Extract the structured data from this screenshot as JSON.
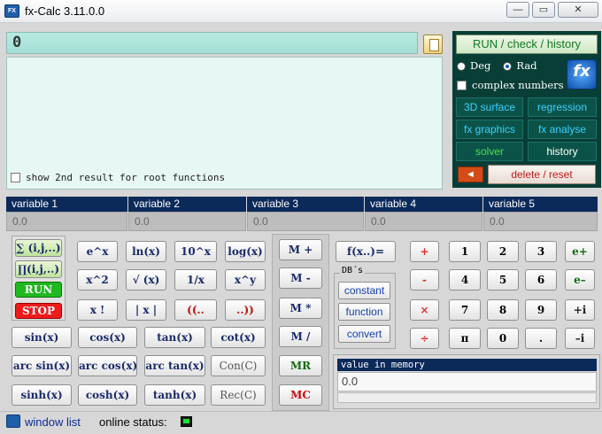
{
  "window": {
    "title": "fx-Calc 3.11.0.0",
    "minimize": "—",
    "restore": "▭",
    "close": "✕"
  },
  "display": {
    "input_value": "0",
    "show_2nd_label": "show 2nd result for root functions"
  },
  "right_panel": {
    "run_check_label": "RUN / check / history",
    "deg_label": "Deg",
    "rad_label": "Rad",
    "angle_mode_selected": "Rad",
    "complex_label": "complex numbers",
    "logo_text": "fx",
    "tools": [
      "3D surface",
      "regression",
      "fx graphics",
      "fx analyse",
      "solver",
      "history"
    ],
    "back_label": "◄",
    "delete_label": "delete / reset"
  },
  "variables": [
    {
      "label": "variable 1",
      "value": "0.0"
    },
    {
      "label": "variable 2",
      "value": "0.0"
    },
    {
      "label": "variable 3",
      "value": "0.0"
    },
    {
      "label": "variable 4",
      "value": "0.0"
    },
    {
      "label": "variable 5",
      "value": "0.0"
    }
  ],
  "keys": {
    "sum": "∑ (i,j,..)",
    "prod": "∏(i,j,..)",
    "run": "RUN",
    "stop": "STOP",
    "exp": "e^x",
    "ln": "ln(x)",
    "pow10": "10^x",
    "log": "log(x)",
    "sq": "x^2",
    "sqrt": "√ (x)",
    "inv": "1/x",
    "pow": "x^y",
    "fact": "x !",
    "abs": "| x |",
    "lparen": "((..",
    "rparen": "..))",
    "sin": "sin(x)",
    "cos": "cos(x)",
    "tan": "tan(x)",
    "cot": "cot(x)",
    "asin": "arc sin(x)",
    "acos": "arc cos(x)",
    "atan": "arc tan(x)",
    "con": "Con(C)",
    "sinh": "sinh(x)",
    "cosh": "cosh(x)",
    "tanh": "tanh(x)",
    "rec": "Rec(C)",
    "mplus": "M +",
    "mminus": "M -",
    "mtimes": "M *",
    "mdiv": "M /",
    "mr": "MR",
    "mc": "MC",
    "fx_eq": "f(x..)=",
    "db_label": "DB´s",
    "constant": "constant",
    "function": "function",
    "convert": "convert",
    "plus": "+",
    "minus": "-",
    "times": "×",
    "divide": "÷",
    "pi": "π",
    "dot": ".",
    "eplus": "e+",
    "eminus": "e–",
    "plus_i": "+i",
    "minus_i": "–i",
    "digits": [
      "1",
      "2",
      "3",
      "4",
      "5",
      "6",
      "7",
      "8",
      "9",
      "0"
    ]
  },
  "memory": {
    "header": "value in memory",
    "value": "0.0"
  },
  "status": {
    "window_list": "window list",
    "online_status": "online status:"
  }
}
